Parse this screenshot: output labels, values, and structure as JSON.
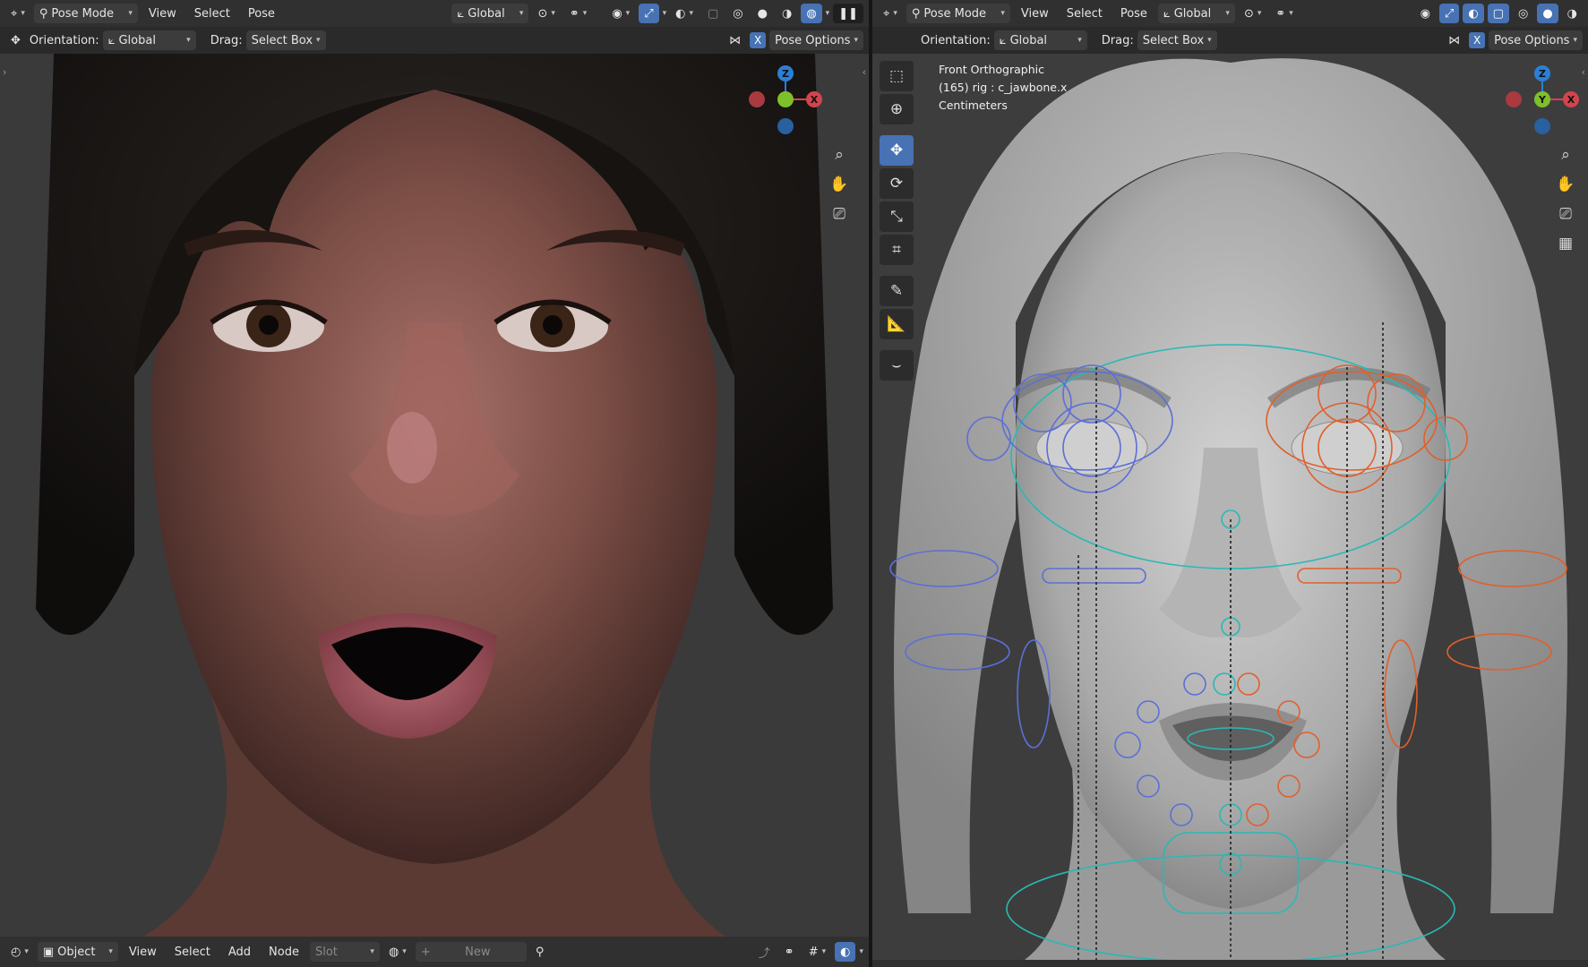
{
  "left": {
    "header": {
      "mode": "Pose Mode",
      "menus": [
        "View",
        "Select",
        "Pose"
      ],
      "transform_orientation": "Global"
    },
    "tool_settings": {
      "orientation_label": "Orientation:",
      "orientation_value": "Global",
      "drag_label": "Drag:",
      "drag_value": "Select Box",
      "x_mirror": "X",
      "pose_options": "Pose Options"
    },
    "footer": {
      "object_mode": "Object",
      "menus": [
        "View",
        "Select",
        "Add",
        "Node"
      ],
      "slot": "Slot",
      "new_label": "New"
    }
  },
  "right": {
    "header": {
      "mode": "Pose Mode",
      "menus": [
        "View",
        "Select",
        "Pose"
      ],
      "transform_orientation": "Global"
    },
    "tool_settings": {
      "orientation_label": "Orientation:",
      "orientation_value": "Global",
      "drag_label": "Drag:",
      "drag_value": "Select Box",
      "x_mirror": "X",
      "pose_options": "Pose Options"
    },
    "overlay": {
      "view_name": "Front Orthographic",
      "bone_info": "(165) rig : c_jawbone.x",
      "units": "Centimeters"
    }
  },
  "gizmo": {
    "x_label": "X",
    "y_label": "Y",
    "z_label": "Z",
    "x_color": "#d3444d",
    "y_color": "#7fbf2a",
    "z_color": "#2b7fd6"
  },
  "icons": {
    "editor_type": "viewport-3d-icon",
    "pose_mode": "pose-mode-icon",
    "transform": "transform-pivot-icon",
    "snap": "snap-icon",
    "proportional": "proportional-edit-icon",
    "visibility": "visibility-eye-icon",
    "gizmos": "gizmo-icon",
    "overlays": "overlay-icon",
    "xray": "xray-icon",
    "shading_wire": "wireframe-shading-icon",
    "shading_solid": "solid-shading-icon",
    "shading_material": "material-shading-icon",
    "shading_rendered": "rendered-shading-icon",
    "pause": "pause-icon",
    "zoom": "zoom-icon",
    "pan": "hand-pan-icon",
    "camera": "camera-icon",
    "ortho_grid": "grid-toggle-icon",
    "tools": [
      "select-box-icon",
      "cursor-icon",
      "move-icon",
      "rotate-icon",
      "scale-icon",
      "transform-icon",
      "annotate-icon",
      "measure-icon",
      "relax-pose-icon"
    ]
  },
  "colors": {
    "accent_blue": "#4772b3",
    "rig_left_blue": "#5c6fd6",
    "rig_right_orange": "#e0602c",
    "rig_center_cyan": "#28b9b4"
  }
}
